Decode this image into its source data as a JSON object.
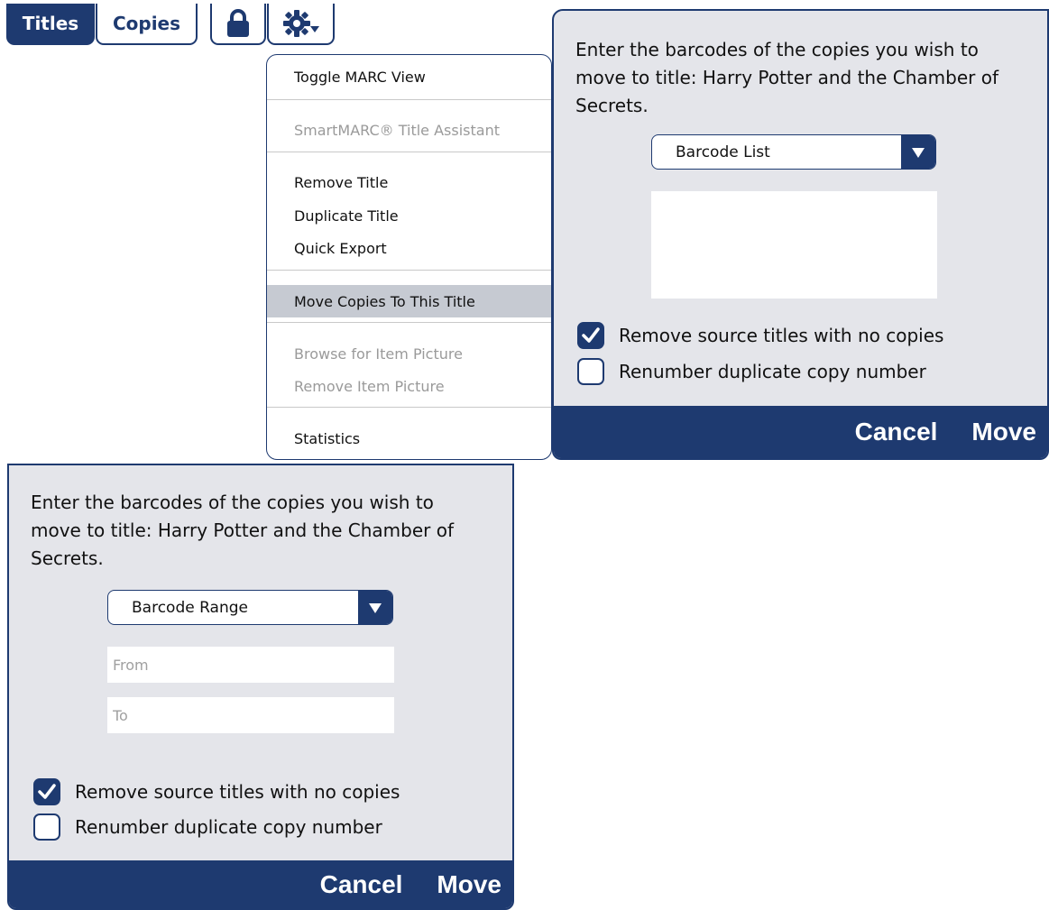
{
  "toolbar": {
    "tabs": [
      {
        "label": "Titles",
        "active": true
      },
      {
        "label": "Copies",
        "active": false
      }
    ],
    "lock_icon": "lock-icon",
    "settings_icon": "gear-icon"
  },
  "menu": {
    "items": [
      {
        "label": "Toggle MARC View",
        "disabled": false
      },
      {
        "label": "SmartMARC® Title Assistant",
        "disabled": true
      },
      {
        "label": "Remove Title",
        "disabled": false
      },
      {
        "label": "Duplicate Title",
        "disabled": false
      },
      {
        "label": "Quick Export",
        "disabled": false
      },
      {
        "label": "Move Copies To This Title",
        "disabled": false,
        "highlighted": true
      },
      {
        "label": "Browse for Item Picture",
        "disabled": true
      },
      {
        "label": "Remove Item Picture",
        "disabled": true
      },
      {
        "label": "Statistics",
        "disabled": false
      }
    ]
  },
  "dialog_list": {
    "prompt": "Enter the barcodes of the copies you wish to move to title: Harry Potter and the Chamber of Secrets.",
    "select_value": "Barcode List",
    "options": [
      {
        "label": "Remove source titles with no copies",
        "checked": true
      },
      {
        "label": "Renumber duplicate copy number",
        "checked": false
      }
    ],
    "cancel_label": "Cancel",
    "move_label": "Move"
  },
  "dialog_range": {
    "prompt": "Enter the barcodes of the copies you wish to move to title: Harry Potter and the Chamber of Secrets.",
    "select_value": "Barcode Range",
    "from_placeholder": "From",
    "to_placeholder": "To",
    "options": [
      {
        "label": "Remove source titles with no copies",
        "checked": true
      },
      {
        "label": "Renumber duplicate copy number",
        "checked": false
      }
    ],
    "cancel_label": "Cancel",
    "move_label": "Move"
  },
  "colors": {
    "brand": "#1e3a70",
    "dialog_bg": "#e4e5ea",
    "menu_highlight": "#c6cad2",
    "disabled_text": "#9a9a9a"
  }
}
